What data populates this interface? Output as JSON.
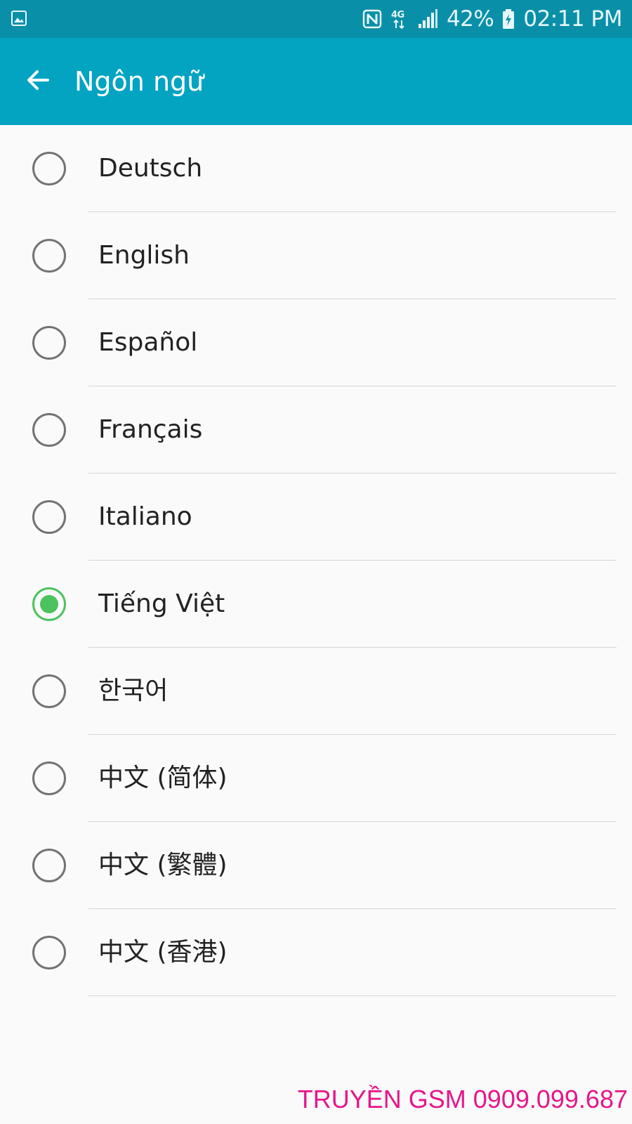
{
  "status_bar": {
    "left_icon": "gallery-icon",
    "icons": [
      "nfc-icon",
      "network-4g-icon",
      "signal-icon"
    ],
    "battery_percent": "42%",
    "battery_icon": "battery-charging-icon",
    "time": "02:11 PM"
  },
  "header": {
    "back_icon": "arrow-back-icon",
    "title": "Ngôn ngữ"
  },
  "languages": [
    {
      "label": "Deutsch",
      "selected": false
    },
    {
      "label": "English",
      "selected": false
    },
    {
      "label": "Español",
      "selected": false
    },
    {
      "label": "Français",
      "selected": false
    },
    {
      "label": "Italiano",
      "selected": false
    },
    {
      "label": "Tiếng Việt",
      "selected": true
    },
    {
      "label": "한국어",
      "selected": false
    },
    {
      "label": "中文 (简体)",
      "selected": false
    },
    {
      "label": "中文 (繁體)",
      "selected": false
    },
    {
      "label": "中文 (香港)",
      "selected": false
    }
  ],
  "watermark": "TRUYỀN GSM 0909.099.687",
  "colors": {
    "status_bar": "#0a8fa8",
    "app_bar": "#03a3c2",
    "radio_selected": "#4cc35e",
    "watermark": "#e6168a"
  }
}
